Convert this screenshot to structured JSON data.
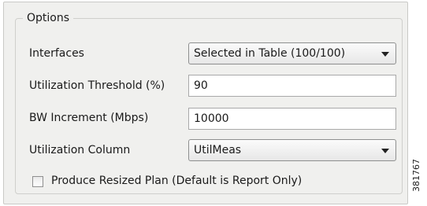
{
  "options": {
    "title": "Options",
    "interfaces": {
      "label": "Interfaces",
      "value": "Selected in Table (100/100)"
    },
    "utilization_threshold": {
      "label": "Utilization Threshold (%)",
      "value": "90"
    },
    "bw_increment": {
      "label": "BW Increment (Mbps)",
      "value": "10000"
    },
    "utilization_column": {
      "label": "Utilization Column",
      "value": "UtilMeas"
    },
    "produce_resized_plan": {
      "label": "Produce Resized Plan (Default is Report Only)",
      "checked": false
    }
  },
  "figure_id": "381767",
  "icons": {
    "dropdown": "chevron-down-icon",
    "checkbox": "checkbox-unchecked-icon"
  },
  "colors": {
    "panel_background": "#f0f0ee",
    "field_background": "#ffffff"
  }
}
